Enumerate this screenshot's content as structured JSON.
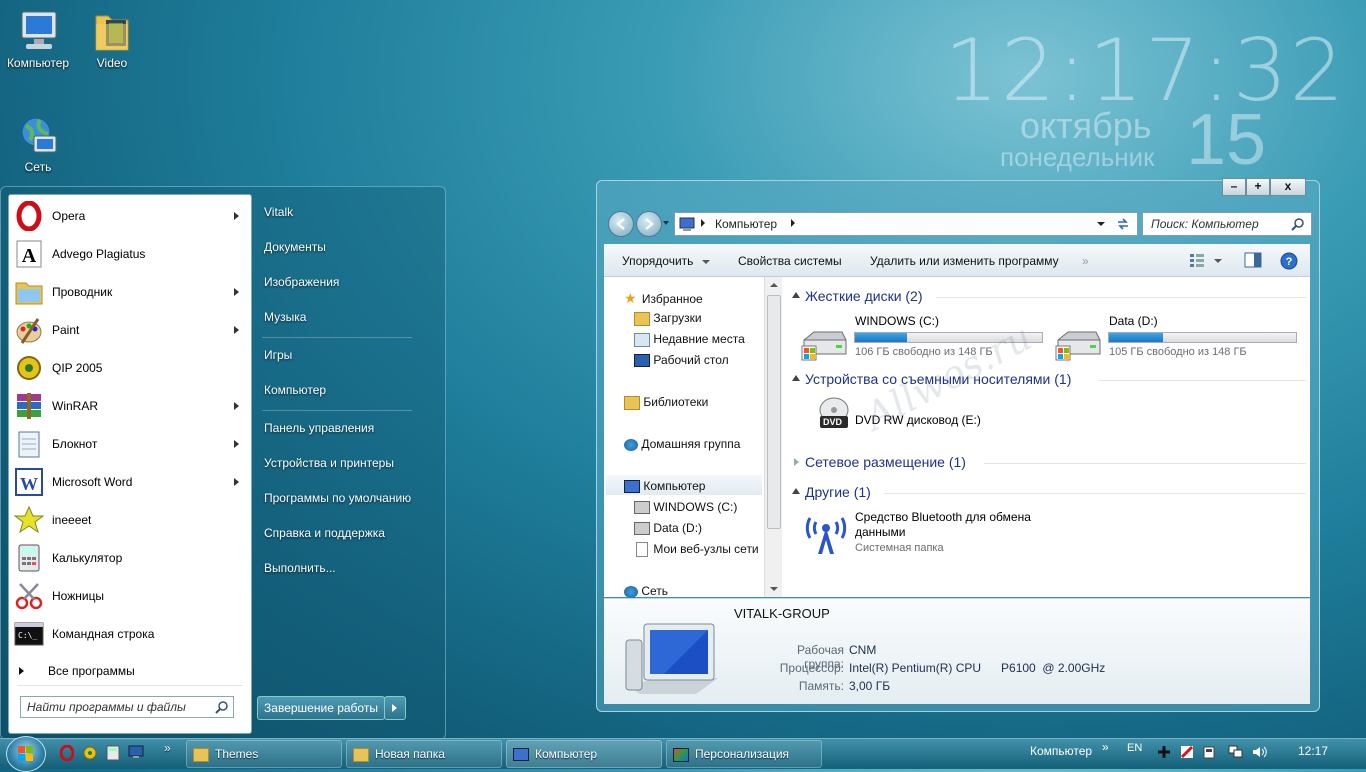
{
  "desktop": {
    "icons": [
      {
        "label": "Компьютер"
      },
      {
        "label": "Video"
      },
      {
        "label": "Сеть"
      }
    ]
  },
  "clock": {
    "time": "12:17:32",
    "month": "октябрь",
    "weekday": "понедельник",
    "day": "15"
  },
  "start_menu": {
    "programs": [
      {
        "label": "Opera",
        "icon": "opera-icon",
        "has_arrow": true
      },
      {
        "label": "Advego Plagiatus",
        "icon": "advego-icon",
        "has_arrow": false
      },
      {
        "label": "Проводник",
        "icon": "explorer-icon",
        "has_arrow": true
      },
      {
        "label": "Paint",
        "icon": "paint-icon",
        "has_arrow": true
      },
      {
        "label": "QIP 2005",
        "icon": "qip-icon",
        "has_arrow": false
      },
      {
        "label": "WinRAR",
        "icon": "winrar-icon",
        "has_arrow": true
      },
      {
        "label": "Блокнот",
        "icon": "notepad-icon",
        "has_arrow": true
      },
      {
        "label": "Microsoft Word",
        "icon": "word-icon",
        "has_arrow": true
      },
      {
        "label": "ineeeet",
        "icon": "star-icon",
        "has_arrow": false
      },
      {
        "label": "Калькулятор",
        "icon": "calculator-icon",
        "has_arrow": false
      },
      {
        "label": "Ножницы",
        "icon": "scissors-icon",
        "has_arrow": false
      },
      {
        "label": "Командная строка",
        "icon": "cmd-icon",
        "has_arrow": false
      }
    ],
    "all_programs": "Все программы",
    "search_placeholder": "Найти программы и файлы",
    "shutdown": "Завершение работы",
    "right": [
      "Vitalk",
      "Документы",
      "Изображения",
      "Музыка",
      "Игры",
      "Компьютер",
      "Панель управления",
      "Устройства и принтеры",
      "Программы по умолчанию",
      "Справка и поддержка",
      "Выполнить..."
    ]
  },
  "explorer": {
    "controls": {
      "minimize": "–",
      "maximize": "+",
      "close": "x"
    },
    "address": "Компьютер",
    "search_placeholder": "Поиск: Компьютер",
    "toolbar": {
      "organize": "Упорядочить",
      "system_properties": "Свойства системы",
      "uninstall": "Удалить или изменить программу",
      "more": "»"
    },
    "nav": {
      "favorites": "Избранное",
      "downloads": "Загрузки",
      "recent": "Недавние места",
      "desktop": "Рабочий стол",
      "libraries": "Библиотеки",
      "homegroup": "Домашняя группа",
      "computer": "Компьютер",
      "drive_c": "WINDOWS (C:)",
      "drive_d": "Data (D:)",
      "web": "Мои веб-узлы сети",
      "network": "Сеть"
    },
    "groups": {
      "hard_disks": "Жесткие диски (2)",
      "removable": "Устройства со съемными носителями (1)",
      "network_location": "Сетевое размещение (1)",
      "other": "Другие (1)"
    },
    "drives": [
      {
        "name": "WINDOWS (C:)",
        "free": "106 ГБ свободно из 148 ГБ",
        "used_fraction": 0.28
      },
      {
        "name": "Data (D:)",
        "free": "105 ГБ свободно из 148 ГБ",
        "used_fraction": 0.29
      }
    ],
    "dvd": {
      "name": "DVD RW дисковод (E:)",
      "badge": "DVD"
    },
    "bluetooth": {
      "name_line1": "Средство Bluetooth для обмена",
      "name_line2": "данными",
      "type": "Системная папка"
    },
    "watermark": "Allwos.ru",
    "details": {
      "computer_name": "VITALK-GROUP",
      "workgroup_label": "Рабочая группа:",
      "workgroup": "CNM",
      "cpu_label": "Процессор:",
      "cpu": "Intel(R) Pentium(R) CPU      P6100  @ 2.00GHz",
      "memory_label": "Память:",
      "memory": "3,00 ГБ"
    }
  },
  "taskbar": {
    "tasks": [
      "Themes",
      "Новая папка",
      "Компьютер",
      "Персонализация"
    ],
    "quick_launch_more": "»",
    "toolbar_label": "Компьютер",
    "toolbar_more": "»",
    "lang": "EN",
    "time": "12:17"
  },
  "colors": {
    "accent": "#1f7f9c",
    "group_heading": "#1e3287",
    "opera_red": "#cc0f16"
  }
}
